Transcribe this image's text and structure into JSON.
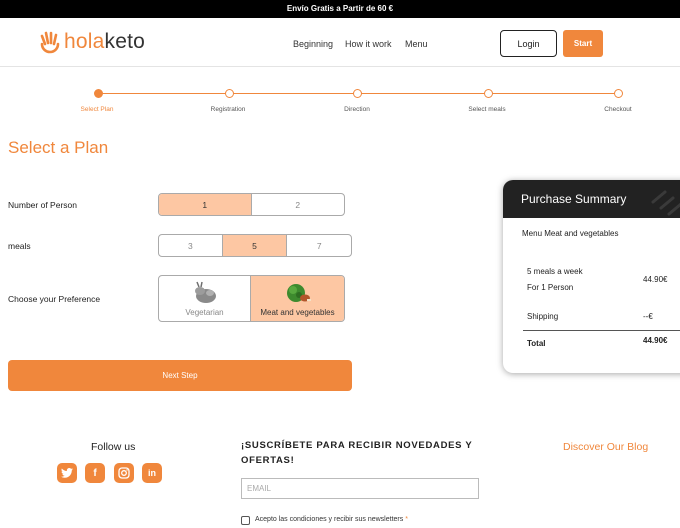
{
  "promo_bar": "Envío Gratis a Partir de 60 €",
  "logo": {
    "hola": "hola",
    "keto": "keto"
  },
  "nav": {
    "items": [
      "Beginning",
      "How it work",
      "Menu"
    ],
    "login": "Login",
    "start": "Start"
  },
  "steps": [
    "Select Plan",
    "Registration",
    "Direction",
    "Select meals",
    "Checkout"
  ],
  "current_step": 0,
  "title": "Select a Plan",
  "persons": {
    "label": "Number of Person",
    "options": [
      "1",
      "2"
    ],
    "selected": "1"
  },
  "meals": {
    "label": "meals",
    "options": [
      "3",
      "5",
      "7"
    ],
    "selected": "5"
  },
  "preference": {
    "label": "Choose your Preference",
    "options": [
      "Vegetarian",
      "Meat and vegetables"
    ],
    "selected": "Meat and vegetables"
  },
  "next_button": "Next Step",
  "summary": {
    "title": "Purchase Summary",
    "menu": "Menu Meat and vegetables",
    "line1": "5 meals a week",
    "line2": "For 1 Person",
    "price": "44.90€",
    "shipping_label": "Shipping",
    "shipping_value": "--€",
    "total_label": "Total",
    "total_value": "44.90€"
  },
  "footer": {
    "follow": "Follow us",
    "socials": [
      "twitter-icon",
      "facebook-icon",
      "instagram-icon",
      "linkedin-icon"
    ],
    "subscribe": "¡SUSCRÍBETE PARA RECIBIR NOVEDADES Y OFERTAS!",
    "email_placeholder": "EMAIL",
    "terms": "Acepto las condiciones y recibir sus newsletters",
    "terms_required": "*",
    "discover": "Discover Our Blog"
  },
  "colors": {
    "accent": "#f0873c",
    "accent_light": "#fdc7a3",
    "dark": "#222222"
  }
}
